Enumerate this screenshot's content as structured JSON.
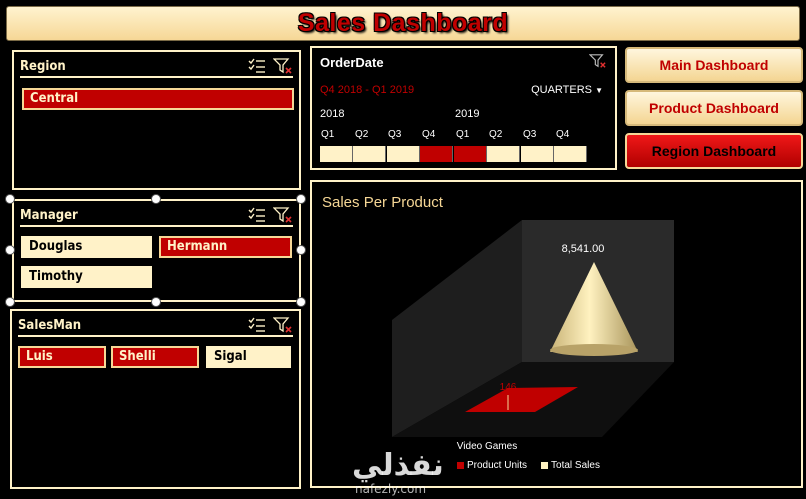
{
  "header": {
    "title": "Sales Dashboard"
  },
  "slicers": {
    "region": {
      "title": "Region",
      "items": [
        {
          "label": "Central",
          "selected": true
        }
      ]
    },
    "manager": {
      "title": "Manager",
      "items": [
        {
          "label": "Douglas",
          "selected": false
        },
        {
          "label": "Hermann",
          "selected": true
        },
        {
          "label": "Timothy",
          "selected": false
        }
      ]
    },
    "salesman": {
      "title": "SalesMan",
      "items": [
        {
          "label": "Luis",
          "selected": true
        },
        {
          "label": "Shelli",
          "selected": true
        },
        {
          "label": "Sigal",
          "selected": false
        }
      ]
    }
  },
  "timeline": {
    "title": "OrderDate",
    "range_label": "Q4 2018 - Q1 2019",
    "level_label": "QUARTERS",
    "years": [
      "2018",
      "2019"
    ],
    "quarters": [
      "Q1",
      "Q2",
      "Q3",
      "Q4",
      "Q1",
      "Q2",
      "Q3",
      "Q4"
    ],
    "selected": [
      false,
      false,
      false,
      true,
      true,
      false,
      false,
      false
    ]
  },
  "nav": {
    "main": "Main Dashboard",
    "product": "Product Dashboard",
    "region": "Region Dashboard"
  },
  "chart_data": {
    "type": "bar",
    "title": "Sales Per Product",
    "categories": [
      "Video Games"
    ],
    "series": [
      {
        "name": "Product Units",
        "values": [
          146
        ]
      },
      {
        "name": "Total Sales",
        "values": [
          8541.0
        ]
      }
    ],
    "data_labels": [
      "146",
      "8,541.00"
    ],
    "legend": "bottom"
  },
  "colors": {
    "accent_red": "#c00000",
    "cream": "#fff2c8",
    "gold": "#f6d796",
    "background": "#000000"
  },
  "watermark": {
    "arabic": "نفذلي",
    "latin": "nafezly.com"
  }
}
